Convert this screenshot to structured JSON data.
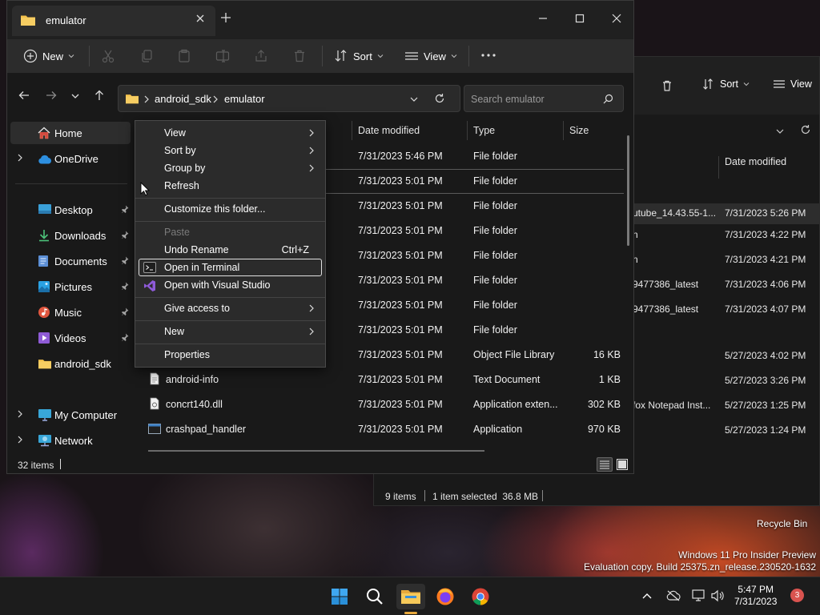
{
  "front_window": {
    "tab_title": "emulator",
    "toolbar": {
      "new_label": "New",
      "sort_label": "Sort",
      "view_label": "View"
    },
    "breadcrumbs": [
      "android_sdk",
      "emulator"
    ],
    "search_placeholder": "Search emulator",
    "sidebar": {
      "home": "Home",
      "onedrive": "OneDrive",
      "desktop": "Desktop",
      "downloads": "Downloads",
      "documents": "Documents",
      "pictures": "Pictures",
      "music": "Music",
      "videos": "Videos",
      "android_sdk": "android_sdk",
      "my_computer": "My Computer",
      "network": "Network"
    },
    "columns": {
      "date": "Date modified",
      "type": "Type",
      "size": "Size"
    },
    "rows": [
      {
        "name": "",
        "date": "7/31/2023 5:46 PM",
        "type": "File folder",
        "size": ""
      },
      {
        "name": "",
        "date": "7/31/2023 5:01 PM",
        "type": "File folder",
        "size": ""
      },
      {
        "name": "",
        "date": "7/31/2023 5:01 PM",
        "type": "File folder",
        "size": ""
      },
      {
        "name": "",
        "date": "7/31/2023 5:01 PM",
        "type": "File folder",
        "size": ""
      },
      {
        "name": "",
        "date": "7/31/2023 5:01 PM",
        "type": "File folder",
        "size": ""
      },
      {
        "name": "",
        "date": "7/31/2023 5:01 PM",
        "type": "File folder",
        "size": ""
      },
      {
        "name": "",
        "date": "7/31/2023 5:01 PM",
        "type": "File folder",
        "size": ""
      },
      {
        "name": "",
        "date": "7/31/2023 5:01 PM",
        "type": "File folder",
        "size": ""
      },
      {
        "name": "",
        "date": "7/31/2023 5:01 PM",
        "type": "Object File Library",
        "size": "16 KB"
      },
      {
        "name": "android-info",
        "date": "7/31/2023 5:01 PM",
        "type": "Text Document",
        "size": "1 KB"
      },
      {
        "name": "concrt140.dll",
        "date": "7/31/2023 5:01 PM",
        "type": "Application exten...",
        "size": "302 KB"
      },
      {
        "name": "crashpad_handler",
        "date": "7/31/2023 5:01 PM",
        "type": "Application",
        "size": "970 KB"
      }
    ],
    "status": "32 items"
  },
  "context_menu": {
    "view": "View",
    "sort_by": "Sort by",
    "group_by": "Group by",
    "refresh": "Refresh",
    "customize": "Customize this folder...",
    "paste": "Paste",
    "undo_rename": "Undo Rename",
    "undo_shortcut": "Ctrl+Z",
    "open_terminal": "Open in Terminal",
    "open_vs": "Open with Visual Studio",
    "give_access": "Give access to",
    "new": "New",
    "properties": "Properties"
  },
  "back_window": {
    "sort_label": "Sort",
    "view_label": "View",
    "date_header": "Date modified",
    "rows": [
      {
        "name": "utube_14.43.55-1...",
        "date": "7/31/2023 5:26 PM"
      },
      {
        "name": "n",
        "date": "7/31/2023 4:22 PM"
      },
      {
        "name": "n",
        "date": "7/31/2023 4:21 PM"
      },
      {
        "name": "9477386_latest",
        "date": "7/31/2023 4:06 PM"
      },
      {
        "name": "9477386_latest",
        "date": "7/31/2023 4:07 PM"
      },
      {
        "name": "",
        "date": "5/27/2023 4:02 PM"
      },
      {
        "name": "",
        "date": "5/27/2023 3:26 PM"
      },
      {
        "name": "fox Notepad Inst...",
        "date": "5/27/2023 1:25 PM"
      },
      {
        "name": "",
        "date": "5/27/2023 1:24 PM"
      }
    ],
    "status_items": "9 items",
    "status_selected": "1 item selected  36.8 MB"
  },
  "desktop": {
    "recycle_bin": "Recycle Bin",
    "watermark_line1": "Windows 11 Pro Insider Preview",
    "watermark_line2": "Evaluation copy. Build 25375.zn_release.230520-1632"
  },
  "taskbar": {
    "time": "5:47 PM",
    "date": "7/31/2023",
    "notification_count": "3",
    "icons": [
      "start-icon",
      "search-icon",
      "file-explorer-icon",
      "firefox-icon",
      "chrome-icon"
    ]
  },
  "colors": {
    "accent_folder": "#f3c14b",
    "window_bg": "#191919",
    "menu_bg": "#2b2b2b",
    "taskbar_indicator": "#e8a93c"
  }
}
